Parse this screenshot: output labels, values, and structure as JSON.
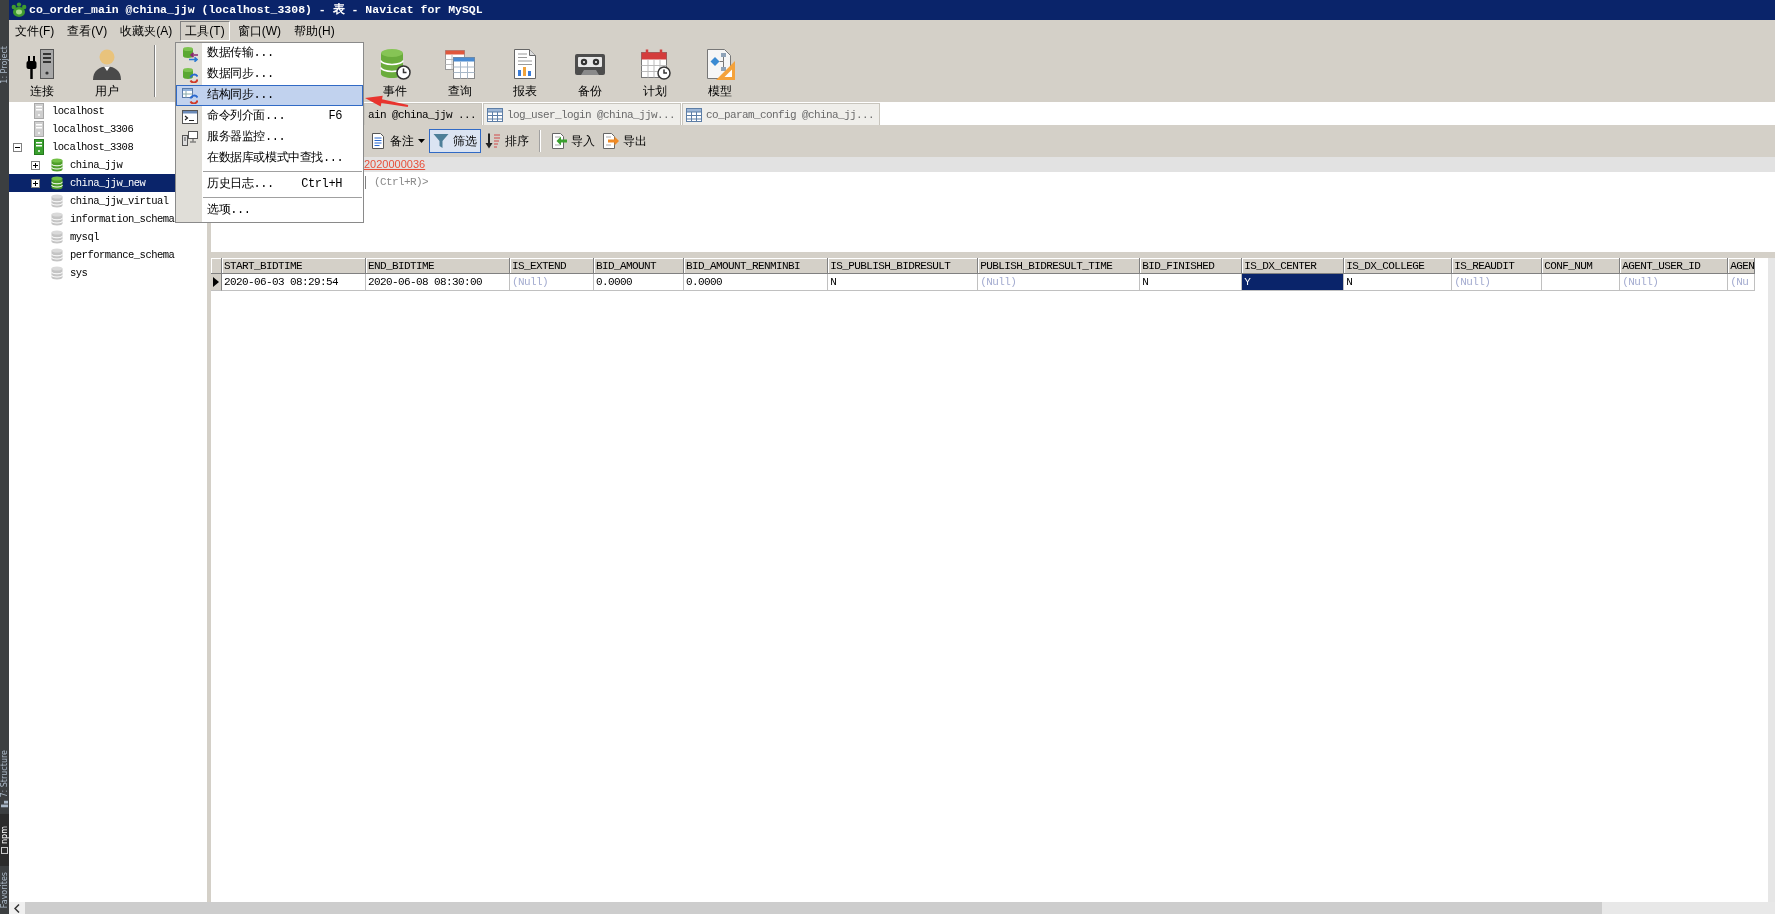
{
  "ide_strip": {
    "top": [
      {
        "label": "1: Project",
        "selected": false
      }
    ],
    "bottom": [
      {
        "label": "7: Structure",
        "selected": false
      },
      {
        "label": "npm",
        "selected": true
      },
      {
        "label": "Favorites",
        "selected": false
      }
    ]
  },
  "window": {
    "title": "co_order_main @china_jjw (localhost_3308) - 表 - Navicat for MySQL"
  },
  "menu_bar": [
    {
      "label": "文件(F)",
      "selected": false
    },
    {
      "label": "查看(V)",
      "selected": false
    },
    {
      "label": "收藏夹(A)",
      "selected": false
    },
    {
      "label": "工具(T)",
      "selected": true
    },
    {
      "label": "窗口(W)",
      "selected": false
    },
    {
      "label": "帮助(H)",
      "selected": false
    }
  ],
  "toolbar": {
    "groups": [
      {
        "buttons": [
          {
            "label": "连接"
          },
          {
            "label": "用户"
          }
        ]
      },
      {
        "buttons": [
          {
            "label": "事件"
          },
          {
            "label": "查询"
          },
          {
            "label": "报表"
          },
          {
            "label": "备份"
          },
          {
            "label": "计划"
          },
          {
            "label": "模型"
          }
        ]
      }
    ]
  },
  "tools_menu": {
    "items": [
      {
        "kind": "item",
        "label": "数据传输...",
        "selected": false
      },
      {
        "kind": "item",
        "label": "数据同步...",
        "selected": false
      },
      {
        "kind": "item",
        "label": "结构同步...",
        "selected": true
      },
      {
        "kind": "item",
        "label": "命令列介面...",
        "shortcut": "F6",
        "selected": false
      },
      {
        "kind": "item",
        "label": "服务器监控...",
        "selected": false
      },
      {
        "kind": "item",
        "label": "在数据库或模式中查找...",
        "selected": false
      },
      {
        "kind": "separator"
      },
      {
        "kind": "item",
        "label": "历史日志...",
        "shortcut": "Ctrl+H",
        "selected": false
      },
      {
        "kind": "separator"
      },
      {
        "kind": "item",
        "label": "选项...",
        "selected": false
      }
    ]
  },
  "annotations": [
    {
      "kind": "arrow"
    }
  ],
  "tree": [
    {
      "label": "localhost",
      "kind": "connection",
      "open": false,
      "selected": false
    },
    {
      "label": "localhost_3306",
      "kind": "connection",
      "open": false,
      "selected": false
    },
    {
      "label": "localhost_3308",
      "kind": "connection",
      "open": true,
      "expanded": true,
      "selected": false,
      "children": [
        {
          "label": "china_jjw",
          "kind": "database",
          "open": true,
          "expanded": false,
          "selected": false
        },
        {
          "label": "china_jjw_new",
          "kind": "database",
          "open": true,
          "expanded": false,
          "selected": true
        },
        {
          "label": "china_jjw_virtual",
          "kind": "database",
          "open": false,
          "selected": false
        },
        {
          "label": "information_schema",
          "kind": "database",
          "open": false,
          "selected": false
        },
        {
          "label": "mysql",
          "kind": "database",
          "open": false,
          "selected": false
        },
        {
          "label": "performance_schema",
          "kind": "database",
          "open": false,
          "selected": false
        },
        {
          "label": "sys",
          "kind": "database",
          "open": false,
          "selected": false
        }
      ]
    }
  ],
  "tabs": [
    {
      "label": "ain @china_jjw ...",
      "selected": true
    },
    {
      "label": "log_user_login @china_jjw...",
      "selected": false
    },
    {
      "label": "co_param_config @china_jj...",
      "selected": false
    }
  ],
  "table_toolbar": {
    "groups": [
      {
        "buttons": [
          {
            "label": "备注",
            "kind": "dropdown",
            "pressed": false
          },
          {
            "label": "筛选",
            "kind": "button",
            "pressed": true
          },
          {
            "label": "排序",
            "kind": "button",
            "pressed": false
          }
        ]
      },
      {
        "buttons": [
          {
            "label": "导入",
            "kind": "button",
            "pressed": false
          },
          {
            "label": "导出",
            "kind": "button",
            "pressed": false
          }
        ]
      }
    ]
  },
  "filter": {
    "condition": "2020000036",
    "hint": "(Ctrl+R)>"
  },
  "grid": {
    "columns": [
      "START_BIDTIME",
      "END_BIDTIME",
      "IS_EXTEND",
      "BID_AMOUNT",
      "BID_AMOUNT_RENMINBI",
      "IS_PUBLISH_BIDRESULT",
      "PUBLISH_BIDRESULT_TIME",
      "BID_FINISHED",
      "IS_DX_CENTER",
      "IS_DX_COLLEGE",
      "IS_REAUDIT",
      "CONF_NUM",
      "AGENT_USER_ID",
      "AGEN"
    ],
    "rows": [
      {
        "current": true,
        "cells": [
          {
            "text": "2020-06-03 08:29:54",
            "kind": "value",
            "selected": false
          },
          {
            "text": "2020-06-08 08:30:00",
            "kind": "value",
            "selected": false
          },
          {
            "text": "(Null)",
            "kind": "null",
            "selected": false
          },
          {
            "text": "0.0000",
            "kind": "value",
            "selected": false
          },
          {
            "text": "0.0000",
            "kind": "value",
            "selected": false
          },
          {
            "text": "N",
            "kind": "value",
            "selected": false
          },
          {
            "text": "(Null)",
            "kind": "null",
            "selected": false
          },
          {
            "text": "N",
            "kind": "value",
            "selected": false
          },
          {
            "text": "Y",
            "kind": "value",
            "selected": true
          },
          {
            "text": "N",
            "kind": "value",
            "selected": false
          },
          {
            "text": "(Null)",
            "kind": "null",
            "selected": false
          },
          {
            "kind": "value",
            "selected": false
          },
          {
            "text": "(Null)",
            "kind": "null",
            "selected": false
          },
          {
            "text": "(Nu",
            "kind": "null",
            "selected": false
          }
        ]
      }
    ]
  }
}
